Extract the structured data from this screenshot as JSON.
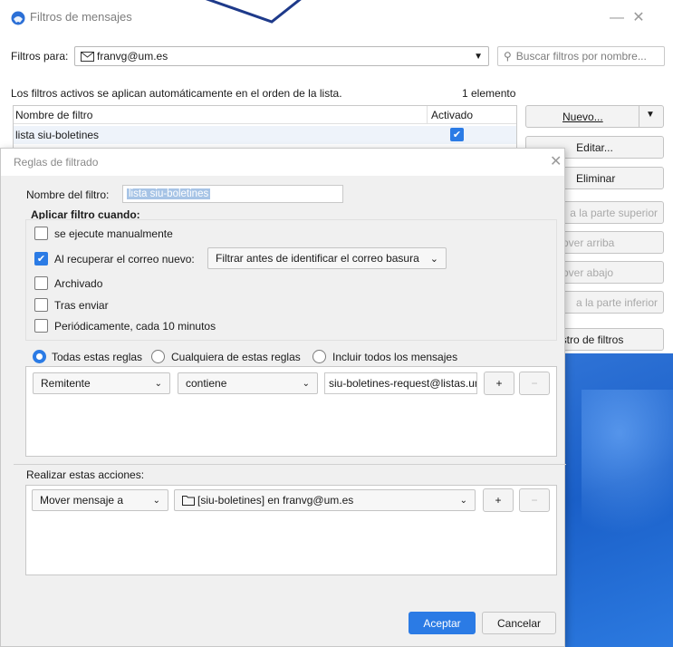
{
  "window": {
    "title": "Filtros de mensajes",
    "controls": {
      "minimize": "—",
      "maximize": "☐",
      "close": "✕"
    }
  },
  "filters_for": {
    "label": "Filtros para:",
    "account": "franvg@um.es",
    "search_placeholder": "Buscar filtros por nombre..."
  },
  "list": {
    "info": "Los filtros activos se aplican automáticamente en el orden de la lista.",
    "count": "1 elemento",
    "col_name": "Nombre de filtro",
    "col_enabled": "Activado",
    "rows": [
      {
        "name": "lista siu-boletines",
        "enabled": true
      }
    ]
  },
  "side_buttons": {
    "new": "Nuevo...",
    "edit": "Editar...",
    "delete": "Eliminar",
    "move_top": "a la parte superior",
    "move_up": "Mover arriba",
    "move_down": "Mover abajo",
    "move_bottom": "a la parte inferior",
    "log": "istro de filtros"
  },
  "dialog": {
    "title": "Reglas de filtrado",
    "close": "✕",
    "name_label": "Nombre del filtro:",
    "name_value": "lista siu-boletines",
    "apply_when": "Aplicar filtro cuando:",
    "opt_manual": "se ejecute manualmente",
    "opt_new_mail": "Al recuperar el correo nuevo:",
    "new_mail_when": "Filtrar antes de identificar el correo basura",
    "opt_archive": "Archivado",
    "opt_after_send": "Tras enviar",
    "opt_periodic": "Periódicamente, cada 10 minutos",
    "match_all": "Todas estas reglas",
    "match_any": "Cualquiera de estas reglas",
    "match_every_msg": "Incluir todos los mensajes",
    "rule": {
      "field": "Remitente",
      "operator": "contiene",
      "value": "siu-boletines-request@listas.um"
    },
    "actions_label": "Realizar estas acciones:",
    "action": {
      "type": "Mover mensaje a",
      "target": "[siu-boletines] en franvg@um.es"
    },
    "plus": "+",
    "minus": "−",
    "ok": "Aceptar",
    "cancel": "Cancelar"
  },
  "colors": {
    "accent": "#2b7be5"
  }
}
